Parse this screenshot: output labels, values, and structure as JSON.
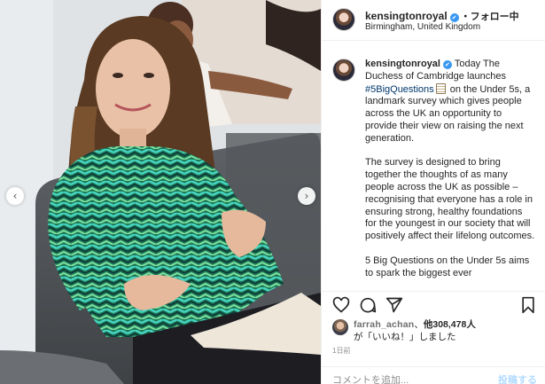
{
  "post": {
    "username": "kensingtonroyal",
    "verified_mark": "✔",
    "follow_label": "・フォロー中",
    "location": "Birmingham, United Kingdom"
  },
  "caption": {
    "username": "kensingtonroyal",
    "para1_before": "Today The Duchess of Cambridge launches ",
    "hashtag": "#5BigQuestions",
    "para1_after": " on the Under 5s, a landmark survey which gives people across the UK an opportunity to provide their view on raising the next generation.",
    "para2": "The survey is designed to bring together the thoughts of as many people across the UK as possible – recognising that everyone has a role in ensuring strong, healthy foundations for the youngest in our society that will positively affect their lifelong outcomes.",
    "para3": "5 Big Questions on the Under 5s aims to spark the biggest ever"
  },
  "likes": {
    "liker": "farrah_achan",
    "separator": "、",
    "count": "他308,478人",
    "suffix": "が「いいね！」しました"
  },
  "time": "1日前",
  "comment": {
    "placeholder": "コメントを追加...",
    "post_label": "投稿する"
  },
  "icons": {
    "like": "heart-icon",
    "comment": "comment-icon",
    "share": "paper-plane-icon",
    "save": "bookmark-icon",
    "prev": "chevron-left-icon",
    "next": "chevron-right-icon"
  },
  "colors": {
    "accent": "#3897f0",
    "hashtag": "#00376b",
    "muted": "#8e8e8e",
    "post_disabled": "#b3dbff"
  }
}
